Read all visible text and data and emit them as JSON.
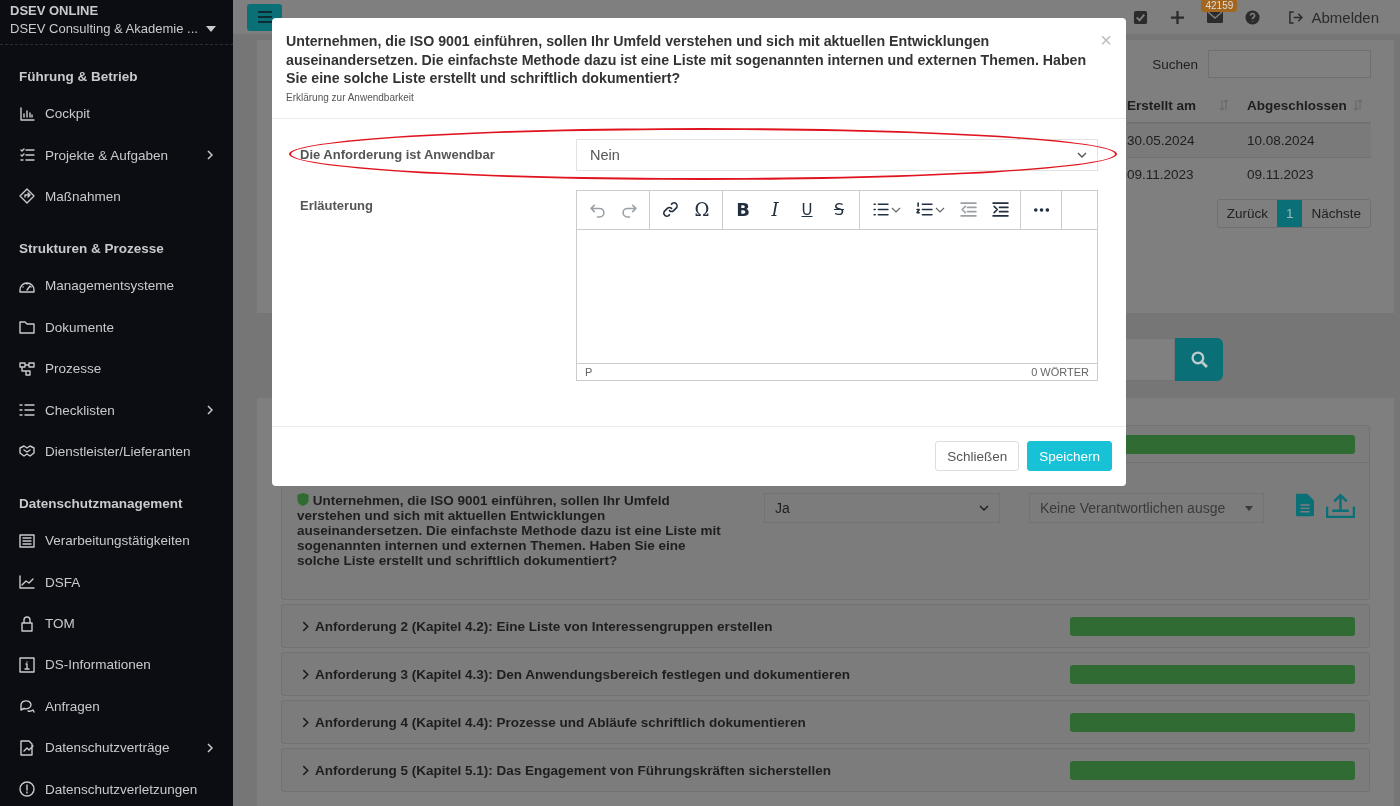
{
  "sidebar": {
    "brand": "DSEV ONLINE",
    "organization": "DSEV Consulting & Akademie ...",
    "sections": [
      {
        "title": "Führung & Betrieb",
        "items": [
          {
            "label": "Cockpit",
            "kind": "chart",
            "expandable": false
          },
          {
            "label": "Projekte & Aufgaben",
            "kind": "tasks",
            "expandable": true
          },
          {
            "label": "Maßnahmen",
            "kind": "diamond",
            "expandable": false
          }
        ]
      },
      {
        "title": "Strukturen & Prozesse",
        "items": [
          {
            "label": "Managementsysteme",
            "kind": "gauge",
            "expandable": false
          },
          {
            "label": "Dokumente",
            "kind": "folder",
            "expandable": false
          },
          {
            "label": "Prozesse",
            "kind": "flow",
            "expandable": false
          },
          {
            "label": "Checklisten",
            "kind": "list",
            "expandable": true
          },
          {
            "label": "Dienstleister/Lieferanten",
            "kind": "handshake",
            "expandable": false
          }
        ]
      },
      {
        "title": "Datenschutzmanagement",
        "items": [
          {
            "label": "Verarbeitungstätigkeiten",
            "kind": "table",
            "expandable": false
          },
          {
            "label": "DSFA",
            "kind": "trend",
            "expandable": false
          },
          {
            "label": "TOM",
            "kind": "lock",
            "expandable": false
          },
          {
            "label": "DS-Informationen",
            "kind": "info",
            "expandable": false
          },
          {
            "label": "Anfragen",
            "kind": "chat",
            "expandable": false
          },
          {
            "label": "Datenschutzverträge",
            "kind": "contract",
            "expandable": true
          },
          {
            "label": "Datenschutzverletzungen",
            "kind": "alert",
            "expandable": false
          }
        ]
      }
    ]
  },
  "topbar": {
    "badge": "42159",
    "logout": "Abmelden"
  },
  "list_panel": {
    "search_label": "Suchen",
    "columns": [
      "Erstellt am",
      "Abgeschlossen"
    ],
    "rows": [
      [
        "30.05.2024",
        "10.08.2024"
      ],
      [
        "09.11.2023",
        "09.11.2023"
      ]
    ],
    "pagination": {
      "previous": "Zurück",
      "pages": [
        {
          "label": "1",
          "selected": true
        }
      ],
      "next": "Nächste"
    }
  },
  "requirements": [
    {
      "expanded": true,
      "level": 1,
      "question": "Unternehmen, die ISO 9001 einführen, sollen Ihr Umfeld verstehen und sich mit aktuellen Entwicklungen auseinandersetzen. Die einfachste Methode dazu ist eine Liste mit sogenannten internen und externen Themen. Haben Sie eine solche Liste erstellt und schriftlich dokumentiert?",
      "answer": "Ja",
      "responsible": "Keine Verantwortlichen ausge"
    },
    {
      "expanded": false,
      "level": 1,
      "title": "Anforderung 2 (Kapitel 4.2): Eine Liste von Interessengruppen erstellen"
    },
    {
      "expanded": false,
      "level": 1,
      "title": "Anforderung 3 (Kapitel 4.3): Den Anwendungsbereich festlegen und dokumentieren"
    },
    {
      "expanded": false,
      "level": 1,
      "title": "Anforderung 4 (Kapitel 4.4): Prozesse und Abläufe schriftlich dokumentieren"
    },
    {
      "expanded": false,
      "level": 1,
      "title": "Anforderung 5 (Kapitel 5.1): Das Engagement von Führungskräften sicherstellen"
    }
  ],
  "modal": {
    "title": "Unternehmen, die ISO 9001 einführen, sollen Ihr Umfeld verstehen und sich mit aktuellen Entwicklungen auseinandersetzen. Die einfachste Methode dazu ist eine Liste mit sogenannten internen und externen Themen. Haben Sie eine solche Liste erstellt und schriftlich dokumentiert?",
    "subtitle": "Erklärung zur Anwendbarkeit",
    "close": "×",
    "applicable_label": "Die Anforderung ist Anwendbar",
    "applicable_value": "Nein",
    "explanation_label": "Erläuterung",
    "toolbar": [
      [
        {
          "kind": "undo",
          "disabled": true,
          "split": false
        },
        {
          "kind": "redo",
          "disabled": true,
          "split": false
        }
      ],
      [
        {
          "kind": "link",
          "disabled": false,
          "split": false
        },
        {
          "kind": "char",
          "text": "Ω",
          "disabled": false,
          "split": false
        }
      ],
      [
        {
          "kind": "bold",
          "text": "B",
          "disabled": false,
          "split": false
        },
        {
          "kind": "italic",
          "text": "I",
          "disabled": false,
          "split": false
        },
        {
          "kind": "underline",
          "text": "U",
          "disabled": false,
          "split": false
        },
        {
          "kind": "strike",
          "text": "S",
          "disabled": false,
          "split": false
        }
      ],
      [
        {
          "kind": "bullets",
          "disabled": false,
          "split": true
        },
        {
          "kind": "numbers",
          "disabled": false,
          "split": true
        },
        {
          "kind": "outdent",
          "disabled": true,
          "split": false
        },
        {
          "kind": "indent",
          "disabled": false,
          "split": false
        }
      ],
      [
        {
          "kind": "more",
          "disabled": false,
          "split": false
        }
      ]
    ],
    "status_path": "P",
    "word_count": "0 WÖRTER",
    "buttons": [
      {
        "label": "Schließen",
        "kind": "secondary"
      },
      {
        "label": "Speichern",
        "kind": "primary"
      }
    ]
  }
}
